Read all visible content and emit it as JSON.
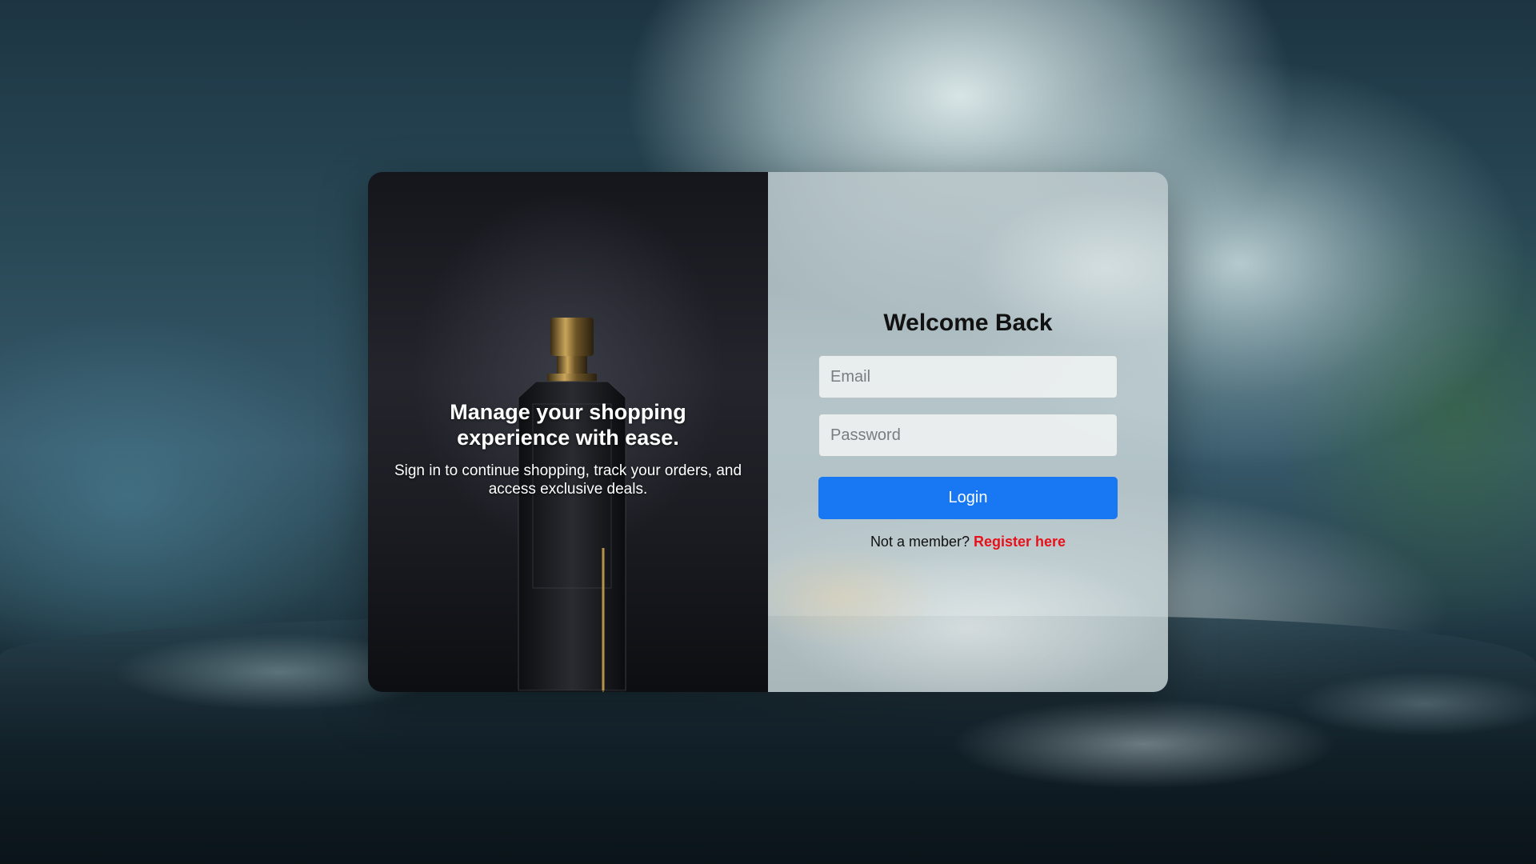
{
  "promo": {
    "heading": "Manage your shopping experience with ease.",
    "subtext": "Sign in to continue shopping, track your orders, and access exclusive deals."
  },
  "login_form": {
    "title": "Welcome Back",
    "email_placeholder": "Email",
    "email_value": "",
    "password_placeholder": "Password",
    "password_value": "",
    "login_label": "Login",
    "register_prompt": "Not a member?",
    "register_link": "Register here"
  },
  "colors": {
    "primary_button": "#1877f2",
    "register_link": "#e8101a"
  },
  "icons": [
    "perfume-bottle-image"
  ]
}
